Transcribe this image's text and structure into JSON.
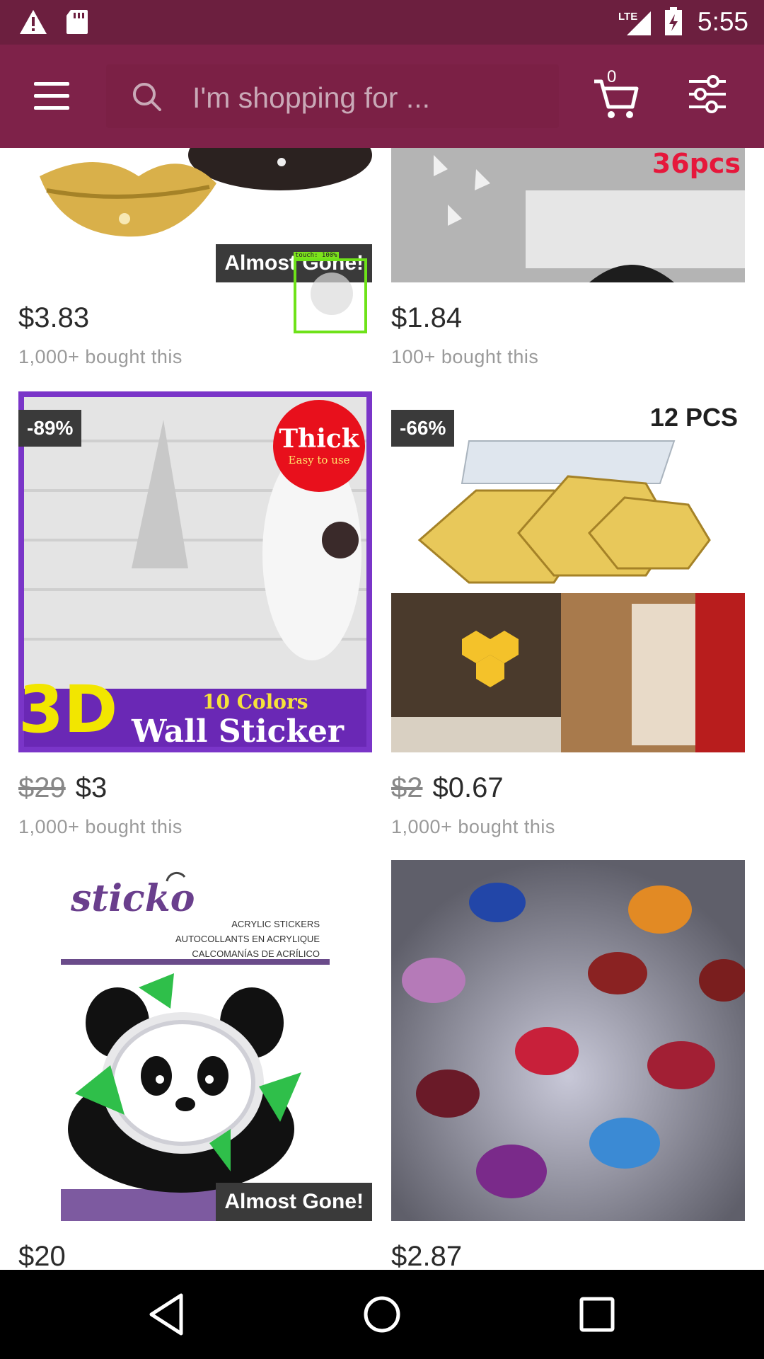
{
  "status_bar": {
    "time": "5:55",
    "network": "LTE",
    "icons": [
      "warning-icon",
      "sd-card-icon",
      "signal-icon",
      "battery-charging-icon"
    ]
  },
  "toolbar": {
    "search_placeholder": "I'm shopping for ...",
    "cart_count": "0",
    "icons": [
      "menu-icon",
      "search-icon",
      "cart-icon",
      "filter-icon"
    ]
  },
  "products": [
    {
      "price": "$3.83",
      "bought": "1,000+ bought this",
      "badge": "Almost Gone!"
    },
    {
      "price": "$1.84",
      "bought": "100+ bought this",
      "image_text": "36pcs"
    },
    {
      "old_price": "$29",
      "price": "$3",
      "bought": "1,000+ bought this",
      "discount": "-89%",
      "image_text": {
        "thick": "Thick",
        "easy": "Easy to use",
        "three_d": "3D",
        "colors": "10 Colors",
        "title": "Wall Sticker"
      }
    },
    {
      "old_price": "$2",
      "price": "$0.67",
      "bought": "1,000+ bought this",
      "discount": "-66%",
      "image_text": "12 PCS"
    },
    {
      "price": "$20",
      "badge": "Almost Gone!",
      "image_text": {
        "brand": "sticko",
        "line1": "ACRYLIC STICKERS",
        "line2": "AUTOCOLLANTS EN ACRYLIQUE",
        "line3": "CALCOMANÍAS DE ACRÍLICO"
      }
    },
    {
      "price": "$2.87"
    }
  ],
  "touch_indicator": "touch: 100%",
  "colors": {
    "status_bar": "#6c1f3f",
    "toolbar": "#7e2249",
    "touch_box": "#6ee219"
  },
  "navbar": {
    "icons": [
      "back-icon",
      "home-icon",
      "recents-icon"
    ]
  }
}
